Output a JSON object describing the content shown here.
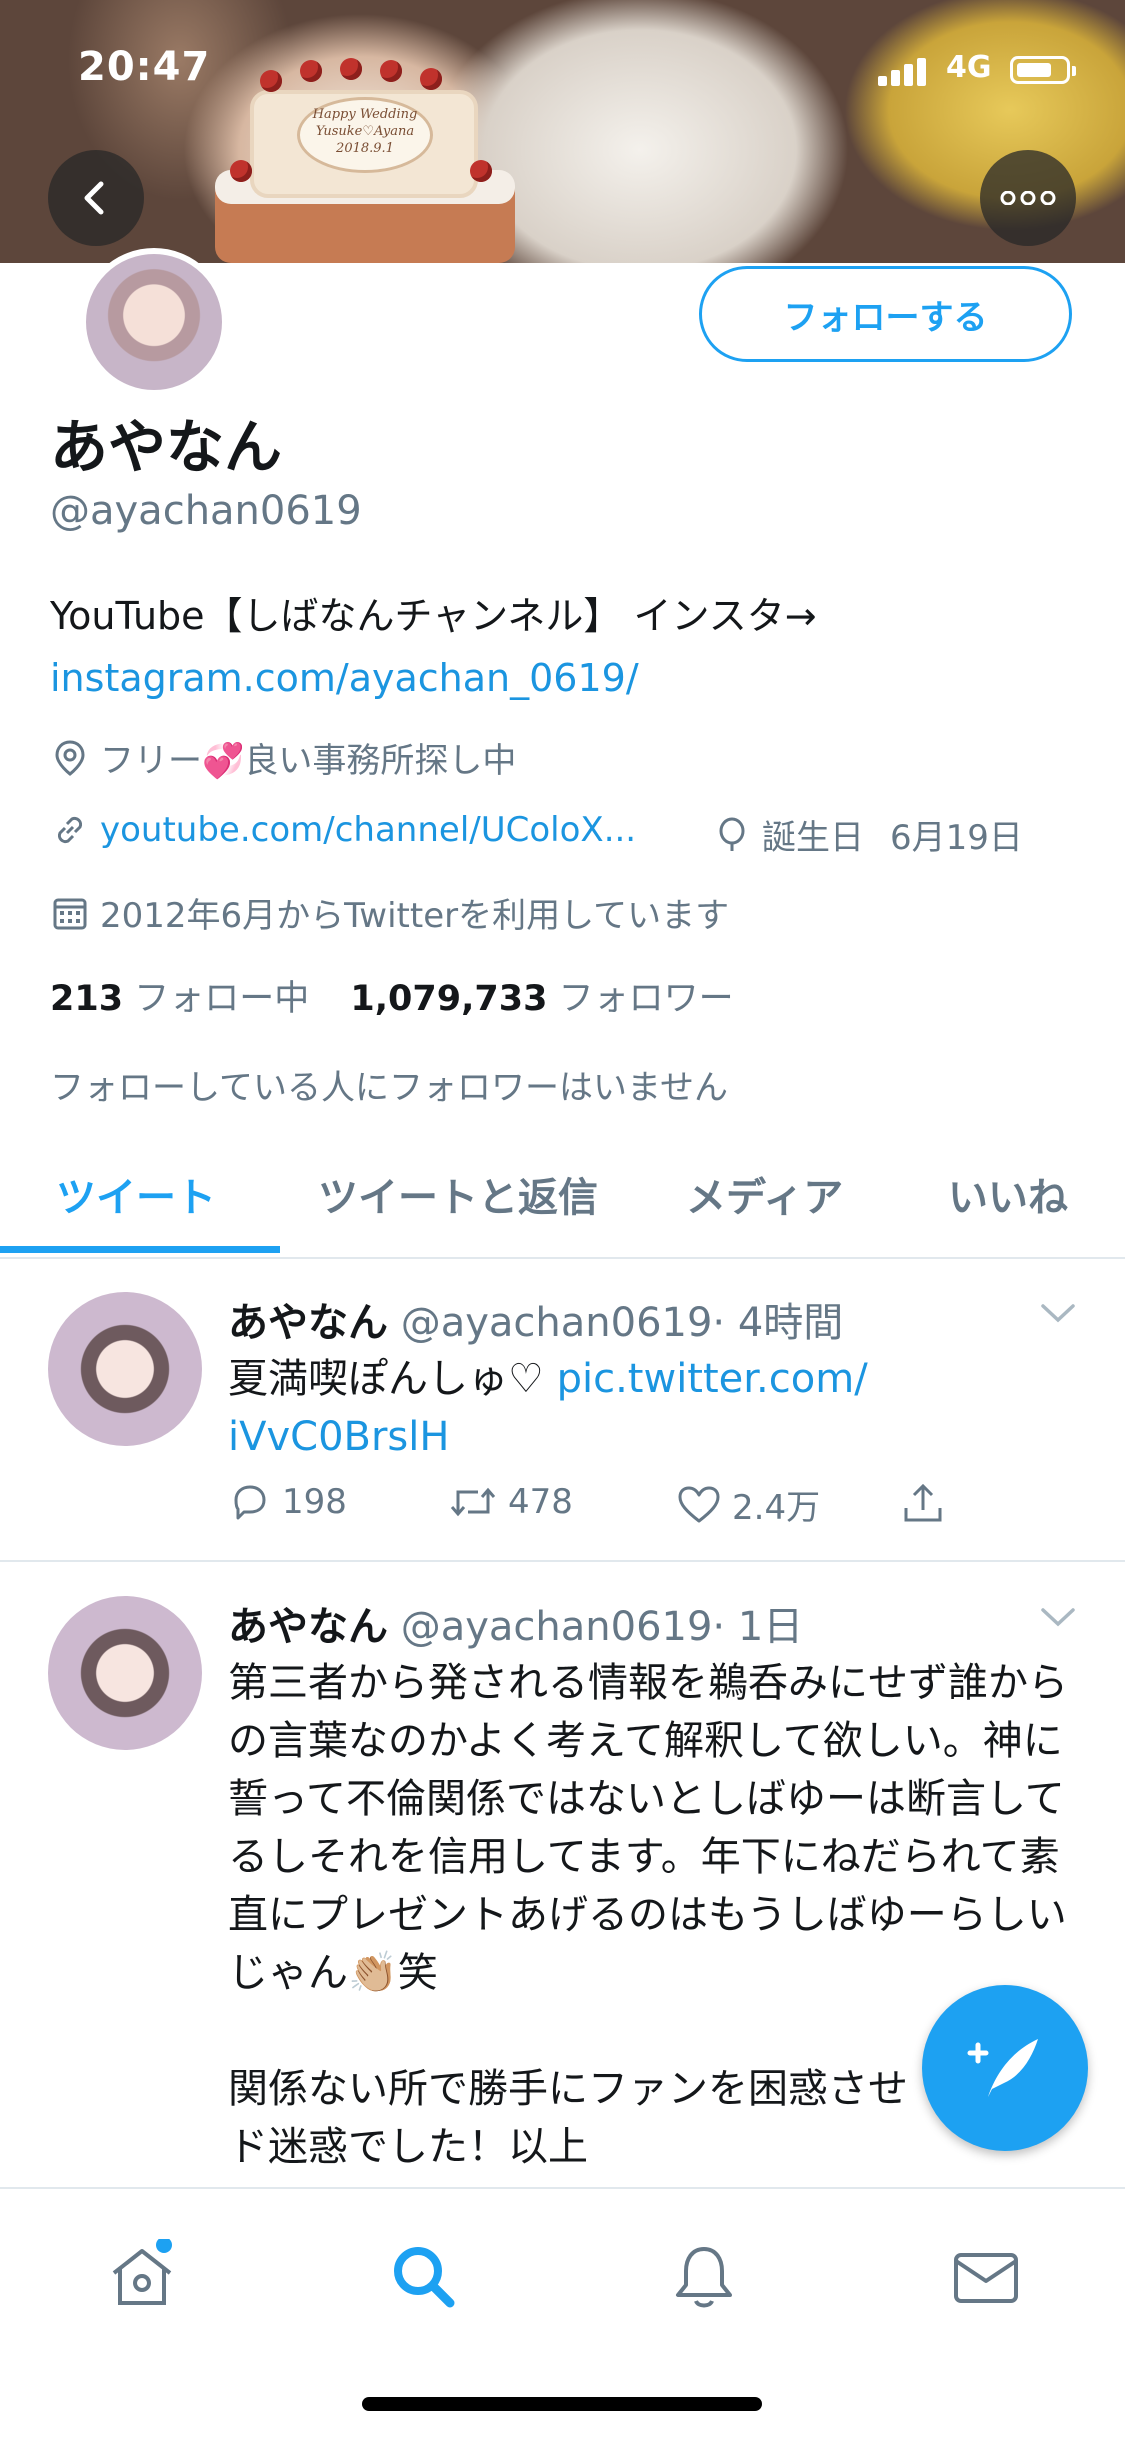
{
  "status_bar": {
    "time": "20:47",
    "network": "4G"
  },
  "profile": {
    "name": "あやなん",
    "handle": "@ayachan0619",
    "follow_label": "フォローする",
    "bio_text": "YouTube【しばなんチャンネル】 インスタ→",
    "bio_link": "instagram.com/ayachan_0619/",
    "location": "フリー💞良い事務所探し中",
    "website": "youtube.com/channel/UColoX...",
    "birthday_label": "誕生日",
    "birthday": "6月19日",
    "joined": "2012年6月からTwitterを利用しています",
    "following_count": "213",
    "following_label": "フォロー中",
    "followers_count": "1,079,733",
    "followers_label": "フォロワー",
    "known_followers": "フォローしている人にフォロワーはいません"
  },
  "banner": {
    "cake_text_1": "Happy Wedding",
    "cake_text_2": "Yusuke♡Ayana",
    "cake_text_3": "2018.9.1"
  },
  "tabs": [
    {
      "label": "ツイート"
    },
    {
      "label": "ツイートと返信"
    },
    {
      "label": "メディア"
    },
    {
      "label": "いいね"
    }
  ],
  "tweets": [
    {
      "name": "あやなん",
      "handle": "@ayachan0619",
      "time": "· 4時間",
      "text": "夏満喫ぽんしゅ♡ ",
      "link": "pic.twitter.com/\niVvC0BrslH",
      "replies": "198",
      "retweets": "478",
      "likes": "2.4万"
    },
    {
      "name": "あやなん",
      "handle": "@ayachan0619",
      "time": "· 1日",
      "text": "第三者から発される情報を鵜呑みにせず誰からの言葉なのかよく考えて解釈して欲しい。神に誓って不倫関係ではないとしばゆーは断言してるしそれを信用してます。年下にねだられて素直にプレゼントあげるのはもうしばゆーらしいじゃん👏🏼笑\n\n関係ない所で勝手にファンを困惑させ\nド迷惑でした！以上"
    }
  ],
  "colors": {
    "accent": "#1da1f2",
    "link": "#1b95e0",
    "muted": "#657786"
  },
  "icons": [
    "back-icon",
    "more-icon",
    "location-pin-icon",
    "link-icon",
    "balloon-icon",
    "calendar-icon",
    "reply-icon",
    "retweet-icon",
    "like-icon",
    "share-icon",
    "chevron-down-icon",
    "compose-icon",
    "home-icon",
    "search-icon",
    "notifications-icon",
    "messages-icon"
  ]
}
